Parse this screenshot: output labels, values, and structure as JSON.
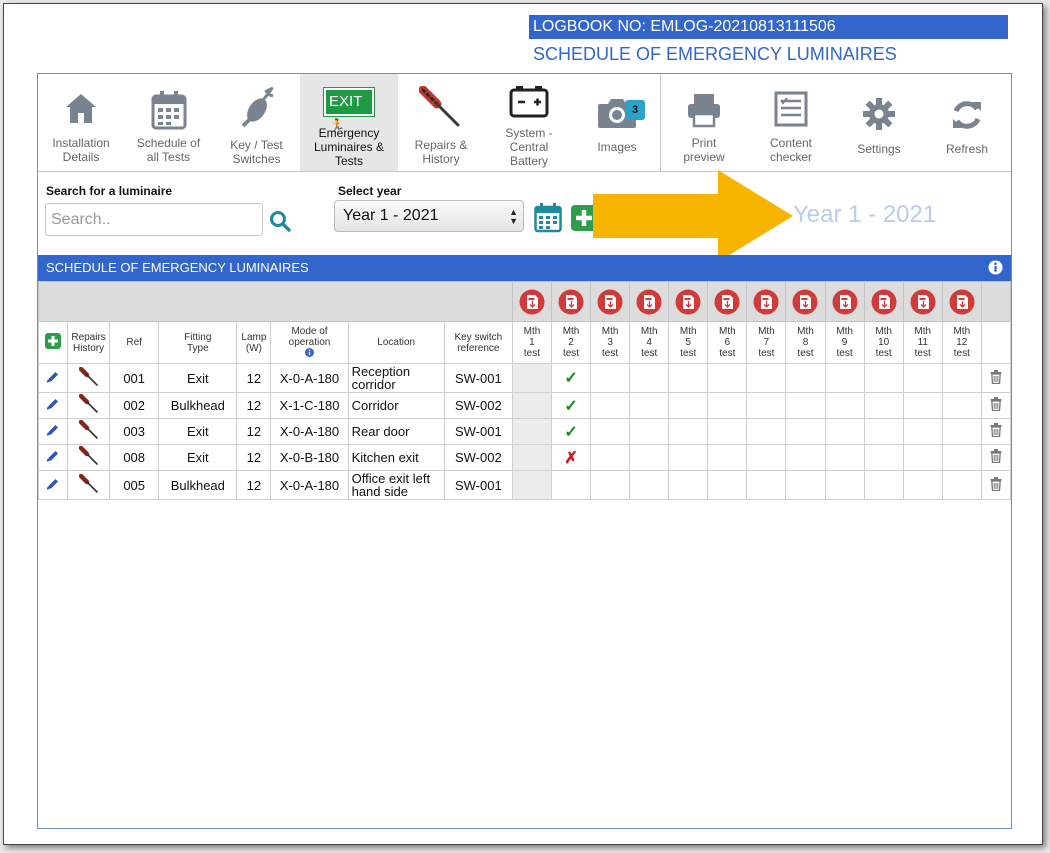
{
  "logbook_no": "LOGBOOK NO: EMLOG-20210813111506",
  "page_heading": "SCHEDULE OF EMERGENCY LUMINAIRES",
  "toolbar": {
    "installation_details": [
      "Installation",
      "Details"
    ],
    "schedule_all_tests": [
      "Schedule of",
      "all Tests"
    ],
    "key_test_switches": [
      "Key / Test",
      "Switches"
    ],
    "emergency_luminaires": [
      "Emergency",
      "Luminaires &",
      "Tests"
    ],
    "exit_sign_text": "EXIT",
    "repairs_history": [
      "Repairs &",
      "History"
    ],
    "system_battery": [
      "System -",
      "Central",
      "Battery"
    ],
    "images": "Images",
    "images_count": "3",
    "print_preview": [
      "Print",
      "preview"
    ],
    "content_checker": [
      "Content",
      "checker"
    ],
    "settings": "Settings",
    "refresh": "Refresh"
  },
  "search": {
    "label": "Search for a luminaire",
    "placeholder": "Search..",
    "value": ""
  },
  "year": {
    "label": "Select year",
    "selected": "Year 1 - 2021",
    "display": "Year 1 - 2021"
  },
  "schedule_bar_title": "SCHEDULE OF EMERGENCY LUMINAIRES",
  "table": {
    "headers": {
      "repairs_history": [
        "Repairs",
        "History"
      ],
      "ref": "Ref",
      "fitting_type": [
        "Fitting",
        "Type"
      ],
      "lamp": [
        "Lamp",
        "(W)"
      ],
      "mode": [
        "Mode of",
        "operation"
      ],
      "location": "Location",
      "key_switch": [
        "Key switch",
        "reference"
      ],
      "months": [
        [
          "Mth",
          "1",
          "test"
        ],
        [
          "Mth",
          "2",
          "test"
        ],
        [
          "Mth",
          "3",
          "test"
        ],
        [
          "Mth",
          "4",
          "test"
        ],
        [
          "Mth",
          "5",
          "test"
        ],
        [
          "Mth",
          "6",
          "test"
        ],
        [
          "Mth",
          "7",
          "test"
        ],
        [
          "Mth",
          "8",
          "test"
        ],
        [
          "Mth",
          "9",
          "test"
        ],
        [
          "Mth",
          "10",
          "test"
        ],
        [
          "Mth",
          "11",
          "test"
        ],
        [
          "Mth",
          "12",
          "test"
        ]
      ]
    },
    "rows": [
      {
        "ref": "001",
        "fitting": "Exit",
        "lamp": "12",
        "mode": "X-0-A-180",
        "location": [
          "Reception",
          "corridor"
        ],
        "key_switch": "SW-001",
        "mth2": "✓"
      },
      {
        "ref": "002",
        "fitting": "Bulkhead",
        "lamp": "12",
        "mode": "X-1-C-180",
        "location": [
          "Corridor"
        ],
        "key_switch": "SW-002",
        "mth2": "✓"
      },
      {
        "ref": "003",
        "fitting": "Exit",
        "lamp": "12",
        "mode": "X-0-A-180",
        "location": [
          "Rear door"
        ],
        "key_switch": "SW-001",
        "mth2": "✓"
      },
      {
        "ref": "008",
        "fitting": "Exit",
        "lamp": "12",
        "mode": "X-0-B-180",
        "location": [
          "Kitchen exit"
        ],
        "key_switch": "SW-002",
        "mth2": "✗"
      },
      {
        "ref": "005",
        "fitting": "Bulkhead",
        "lamp": "12",
        "mode": "X-0-A-180",
        "location": [
          "Office exit left",
          "hand side"
        ],
        "key_switch": "SW-001",
        "mth2": ""
      }
    ]
  },
  "colors": {
    "accent_blue": "#3366cc",
    "pdf_red": "#d23a3a",
    "add_green": "#2e9e4a",
    "arrow_yellow": "#f7b500"
  },
  "icons": {
    "installation_details": "home-icon",
    "schedule_all_tests": "calendar-icon",
    "key_test_switches": "key-switch-icon",
    "emergency_luminaires": "exit-sign-icon",
    "repairs_history": "screwdriver-icon",
    "system_battery": "battery-icon",
    "images": "camera-icon",
    "print_preview": "printer-icon",
    "content_checker": "checklist-icon",
    "settings": "gear-icon",
    "refresh": "refresh-icon",
    "search": "search-icon",
    "edit": "pencil-icon",
    "delete": "trash-icon",
    "pdf": "pdf-download-icon",
    "add": "plus-icon",
    "info": "info-icon"
  }
}
